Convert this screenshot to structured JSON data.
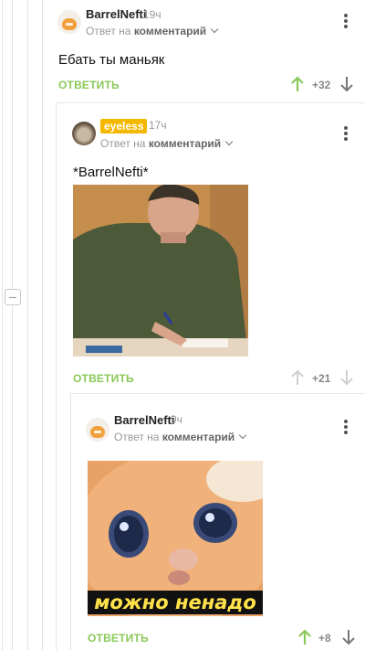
{
  "comments": [
    {
      "author": "BarrelNefti",
      "time": "19ч",
      "reply_prefix": "Ответ на",
      "reply_target": "комментарий",
      "text": "Ебать ты маньяк",
      "reply_label": "ОТВЕТИТЬ",
      "rating": "+32",
      "avatar": "cartoon-cat"
    },
    {
      "author": "eyeless",
      "time": "17ч",
      "reply_prefix": "Ответ на",
      "reply_target": "комментарий",
      "text": "*BarrelNefti*",
      "image": "man-writing-at-desk",
      "reply_label": "ОТВЕТИТЬ",
      "rating": "+21",
      "avatar": "cat-photo",
      "author_badge_color": "#f5b800"
    },
    {
      "author": "BarrelNefti",
      "time": "9ч",
      "reply_prefix": "Ответ на",
      "reply_target": "комментарий",
      "image": "crying-cat-meme",
      "image_caption": "можно ненадо",
      "reply_label": "ОТВЕТИТЬ",
      "rating": "+8",
      "avatar": "cartoon-cat"
    }
  ],
  "colors": {
    "accent_green": "#8ac858",
    "upvote_active": "#8ac858",
    "muted": "#999999",
    "badge": "#f5b800"
  },
  "icons": [
    "kebab-menu-icon",
    "chevron-down-icon",
    "arrow-up-icon",
    "arrow-down-icon",
    "collapse-thread-icon"
  ]
}
